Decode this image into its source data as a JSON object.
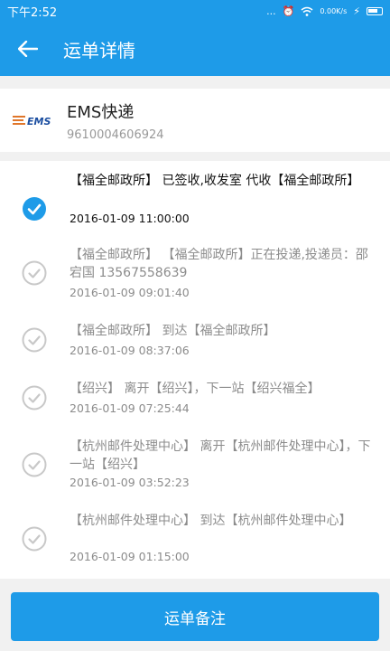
{
  "status_bar": {
    "time": "下午2:52",
    "net": "...",
    "speed": "0.00K/s"
  },
  "app_bar": {
    "title": "运单详情"
  },
  "carrier": {
    "name": "EMS快递",
    "tracking_number": "9610004606924",
    "logo_text": "EMS"
  },
  "timeline": [
    {
      "text": "【福全邮政所】 已签收,收发室 代收【福全邮政所】",
      "date": "2016-01-09 11:00:00",
      "current": true
    },
    {
      "text": "【福全邮政所】 【福全邮政所】正在投递,投递员：邵宕国 13567558639",
      "date": "2016-01-09 09:01:40",
      "current": false
    },
    {
      "text": "【福全邮政所】 到达【福全邮政所】",
      "date": "2016-01-09 08:37:06",
      "current": false
    },
    {
      "text": "【绍兴】 离开【绍兴】，下一站【绍兴福全】",
      "date": "2016-01-09 07:25:44",
      "current": false
    },
    {
      "text": "【杭州邮件处理中心】 离开【杭州邮件处理中心】，下一站【绍兴】",
      "date": "2016-01-09 03:52:23",
      "current": false
    },
    {
      "text": "【杭州邮件处理中心】 到达【杭州邮件处理中心】",
      "date": "2016-01-09 01:15:00",
      "current": false
    }
  ],
  "footer": {
    "button_label": "运单备注"
  },
  "colors": {
    "primary": "#1e9be8",
    "muted": "#8c8c8c",
    "check_gray": "#c8c8c8"
  }
}
